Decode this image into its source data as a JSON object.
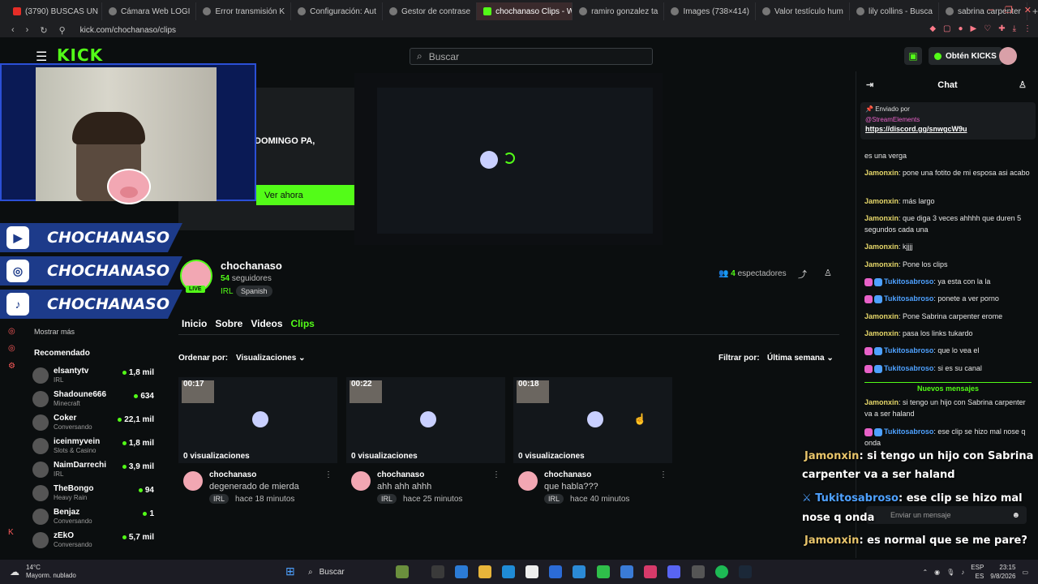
{
  "browser": {
    "tabs": [
      {
        "label": "(3790) BUSCAS UN"
      },
      {
        "label": "Cámara Web LOGI"
      },
      {
        "label": "Error transmisión K"
      },
      {
        "label": "Configuración: Aut"
      },
      {
        "label": "Gestor de contrase"
      },
      {
        "label": "chochanaso Clips - Watch"
      },
      {
        "label": "ramiro gonzalez ta"
      },
      {
        "label": "Images (738×414)"
      },
      {
        "label": "Valor testículo hum"
      },
      {
        "label": "lily collins - Busca"
      },
      {
        "label": "sabrina carpenter"
      }
    ],
    "url": "kick.com/chochanaso/clips"
  },
  "header": {
    "logo": "KICK",
    "search_placeholder": "Buscar",
    "kicks_button": "Obtén KICKS"
  },
  "promo": {
    "title": "DOMINGO PA,",
    "watch_button": "Ver ahora"
  },
  "social": [
    {
      "icon": "youtube-icon",
      "name": "CHOCHANASO"
    },
    {
      "icon": "instagram-icon",
      "name": "CHOCHANASO"
    },
    {
      "icon": "tiktok-icon",
      "name": "CHOCHANASO"
    }
  ],
  "sidebar": {
    "show_more": "Mostrar más",
    "recommended_title": "Recomendado",
    "recommended": [
      {
        "name": "elsantytv",
        "category": "IRL",
        "viewers": "1,8 mil"
      },
      {
        "name": "Shadoune666",
        "category": "Minecraft",
        "viewers": "634"
      },
      {
        "name": "Coker",
        "category": "Conversando",
        "viewers": "22,1 mil"
      },
      {
        "name": "iceinmyvein",
        "category": "Slots & Casino",
        "viewers": "1,8 mil"
      },
      {
        "name": "NaimDarrechi",
        "category": "IRL",
        "viewers": "3,9 mil"
      },
      {
        "name": "TheBongo",
        "category": "Heavy Rain",
        "viewers": "94"
      },
      {
        "name": "Benjaz",
        "category": "Conversando",
        "viewers": "1"
      },
      {
        "name": "zEkO",
        "category": "Conversando",
        "viewers": "5,7 mil"
      }
    ]
  },
  "channel": {
    "name": "chochanaso",
    "followers_count": "54",
    "followers_label": "seguidores",
    "category": "IRL",
    "language": "Spanish",
    "live_badge": "LIVE",
    "viewers_count": "4",
    "viewers_label": "espectadores",
    "tabs": [
      "Inicio",
      "Sobre",
      "Videos",
      "Clips"
    ],
    "order_label": "Ordenar por:",
    "order_value": "Visualizaciones",
    "filter_label": "Filtrar por:",
    "filter_value": "Última semana"
  },
  "clips": [
    {
      "duration": "00:17",
      "views": "0 visualizaciones",
      "author": "chochanaso",
      "title": "degenerado de mierda",
      "tag": "IRL",
      "ago": "hace 18 minutos"
    },
    {
      "duration": "00:22",
      "views": "0 visualizaciones",
      "author": "chochanaso",
      "title": "ahh ahh ahhh",
      "tag": "IRL",
      "ago": "hace 25 minutos"
    },
    {
      "duration": "00:18",
      "views": "0 visualizaciones",
      "author": "chochanaso",
      "title": "que habla???",
      "tag": "IRL",
      "ago": "hace 40 minutos"
    }
  ],
  "chat": {
    "title": "Chat",
    "pinned_label": "Enviado por",
    "pinned_user": "@StreamElements",
    "pinned_link": "https://discord.gg/snwgcW9u",
    "messages": [
      {
        "user": "",
        "text": "es una verga",
        "badge": false
      },
      {
        "user": "Jamonxin",
        "text": ": pone una fotito de mi esposa asi acabo",
        "badge": false
      },
      {
        "user": "Jamonxin",
        "text": ": más largo",
        "badge": false
      },
      {
        "user": "Jamonxin",
        "text": ": que diga 3 veces ahhhh que duren 5 segundos cada una",
        "badge": false
      },
      {
        "user": "Jamonxin",
        "text": ": kjjjj",
        "badge": false
      },
      {
        "user": "Jamonxin",
        "text": ": Pone los clips",
        "badge": false
      },
      {
        "user": "Tukitosabroso",
        "text": ": ya esta con la la",
        "badge": true
      },
      {
        "user": "Tukitosabroso",
        "text": ": ponete a ver porno",
        "badge": true
      },
      {
        "user": "Jamonxin",
        "text": ": Pone Sabrina carpenter erome",
        "badge": false
      },
      {
        "user": "Jamonxin",
        "text": ": pasa los links tukardo",
        "badge": false
      },
      {
        "user": "Tukitosabroso",
        "text": ": que lo vea el",
        "badge": true
      },
      {
        "user": "Tukitosabroso",
        "text": ": si es su canal",
        "badge": true
      },
      {
        "user": "Jamonxin",
        "text": ": si tengo un hijo con Sabrina carpenter va a ser haland",
        "badge": false
      },
      {
        "user": "Tukitosabroso",
        "text": ": ese clip se hizo mal nose q onda",
        "badge": true
      }
    ],
    "new_messages": "Nuevos mensajes",
    "input_placeholder": "Enviar un mensaje"
  },
  "overlay_chat": [
    {
      "user": "Jamonxin",
      "text": ": si tengo un hijo con Sabrina",
      "cont": "carpenter va a ser haland"
    },
    {
      "user": "Tukitosabroso",
      "text": ": ese clip se hizo mal",
      "cont": "nose q onda"
    },
    {
      "user": "Jamonxin",
      "text": ": es normal que se me pare?",
      "cont": ""
    }
  ],
  "taskbar": {
    "temp": "14°C",
    "weather": "Mayorm. nublado",
    "search": "Buscar",
    "lang": "ESP",
    "lang2": "ES",
    "time": "23:15",
    "date": "9/8/2026"
  }
}
